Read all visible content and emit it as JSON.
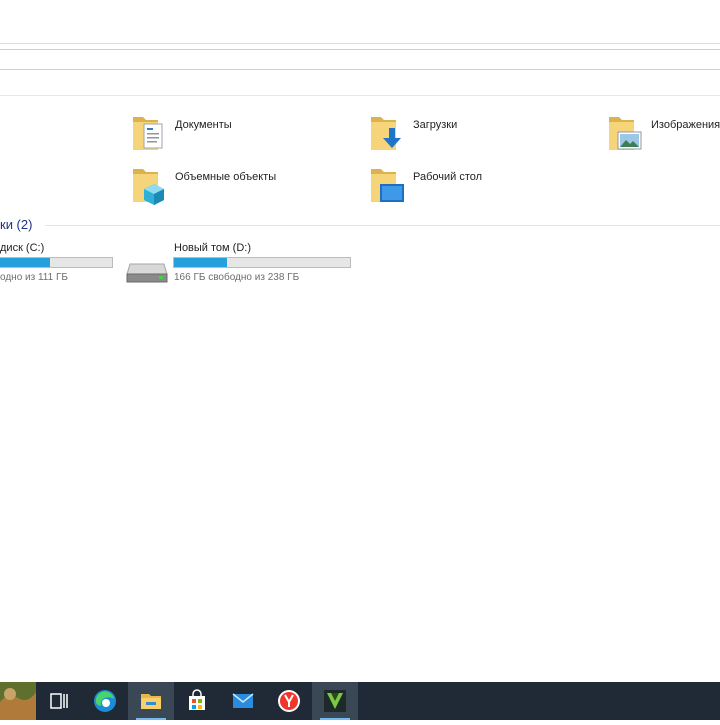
{
  "quick_folders": [
    {
      "name": "Документы",
      "icon": "documents-folder-icon"
    },
    {
      "name": "Загрузки",
      "icon": "downloads-folder-icon"
    },
    {
      "name": "Изображения",
      "icon": "pictures-folder-icon"
    },
    {
      "name": "Объемные объекты",
      "icon": "3d-objects-folder-icon"
    },
    {
      "name": "Рабочий стол",
      "icon": "desktop-folder-icon"
    }
  ],
  "devices_group": {
    "label": "ки (2)"
  },
  "drives": [
    {
      "name": "диск (C:)",
      "free_text": "одно из 111 ГБ",
      "used_fraction": 0.49,
      "icon": "windows-drive-icon"
    },
    {
      "name": "Новый том (D:)",
      "free_text": "166 ГБ свободно из 238 ГБ",
      "used_fraction": 0.3,
      "icon": "hard-drive-icon"
    }
  ],
  "taskbar": {
    "items": [
      {
        "name": "task-view",
        "icon": "task-view-icon",
        "active": false
      },
      {
        "name": "edge",
        "icon": "edge-icon",
        "active": false
      },
      {
        "name": "file-explorer",
        "icon": "file-explorer-icon",
        "active": true
      },
      {
        "name": "microsoft-store",
        "icon": "store-icon",
        "active": false
      },
      {
        "name": "mail",
        "icon": "mail-icon",
        "active": false
      },
      {
        "name": "yandex-browser",
        "icon": "yandex-icon",
        "active": false
      },
      {
        "name": "vectorworks",
        "icon": "v-app-icon",
        "active": true
      }
    ]
  },
  "colors": {
    "accent": "#26a0da",
    "group_header": "#1e3287",
    "taskbar": "#1f2a36"
  }
}
